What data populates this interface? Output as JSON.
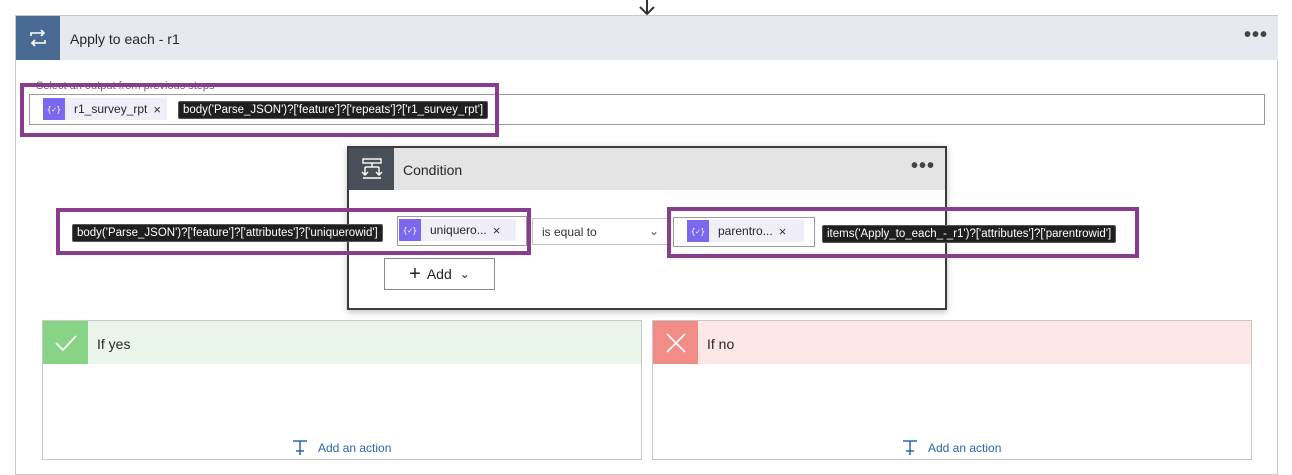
{
  "apply_to_each": {
    "title": "Apply to each - r1",
    "more_label": "•••",
    "select_label": "Select an output from previous steps",
    "token": {
      "label": "r1_survey_rpt",
      "icon": "expression-icon",
      "close": "×"
    },
    "tooltip": "body('Parse_JSON')?['feature']?['repeats']?['r1_survey_rpt']"
  },
  "condition": {
    "title": "Condition",
    "more_label": "•••",
    "left_tooltip": "body('Parse_JSON')?['feature']?['attributes']?['uniquerowid']",
    "left_token": {
      "label": "uniquero...",
      "close": "×"
    },
    "operator": "is equal to",
    "right_token": {
      "label": "parentro...",
      "close": "×"
    },
    "right_tooltip": "items('Apply_to_each_-_r1')?['attributes']?['parentrowid']",
    "add_label": "Add"
  },
  "branches": {
    "yes": {
      "title": "If yes",
      "add_action": "Add an action",
      "color": "#87d486"
    },
    "no": {
      "title": "If no",
      "add_action": "Add an action",
      "color": "#f28c87"
    }
  },
  "colors": {
    "highlight": "#8a3c8d",
    "token_icon": "#7b68ee",
    "apply_header": "#486991",
    "condition_header": "#484f58"
  }
}
